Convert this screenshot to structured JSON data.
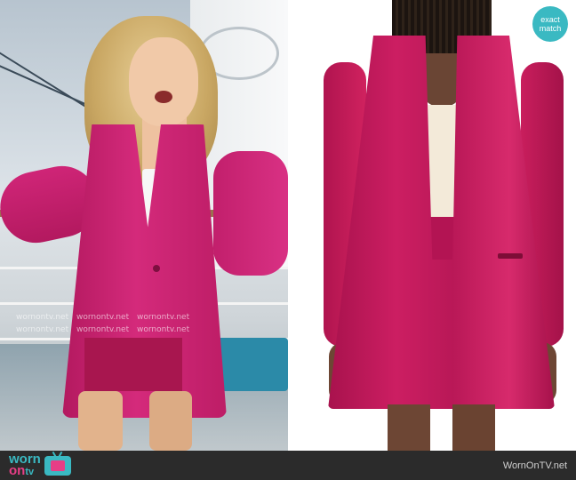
{
  "left_photo": {
    "watermark_lines": [
      [
        "wornontv.net",
        "wornontv.net",
        "wornontv.net"
      ],
      [
        "wornontv.net",
        "wornontv.net",
        "wornontv.net"
      ]
    ]
  },
  "right_photo": {
    "badge": {
      "line1": "exact",
      "line2": "match"
    }
  },
  "footer": {
    "logo": {
      "part1": "worn",
      "part2": "on",
      "part3": "tv"
    },
    "site": "WornOnTV.net"
  },
  "colors": {
    "accent_teal": "#3ab9c2",
    "accent_pink": "#e73e86",
    "blazer_pink": "#c91e62",
    "footer_bg": "#2b2b2b"
  },
  "icons": [
    "tv-icon"
  ]
}
